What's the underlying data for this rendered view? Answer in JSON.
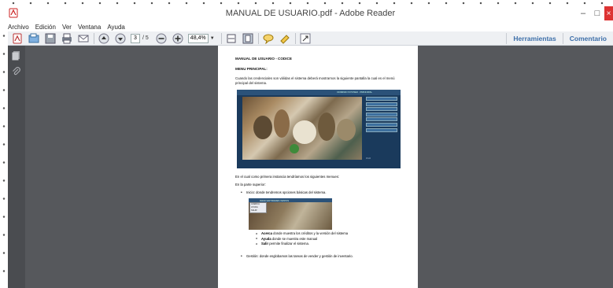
{
  "window": {
    "title": "MANUAL DE USUARIO.pdf - Adobe Reader",
    "minimize_glyph": "–",
    "maximize_glyph": "□",
    "close_glyph": "×"
  },
  "menu": {
    "items": [
      "Archivo",
      "Edición",
      "Ver",
      "Ventana",
      "Ayuda"
    ]
  },
  "toolbar": {
    "current_page": "3",
    "total_pages": "/ 5",
    "zoom": "48,4%",
    "tools_label": "Herramientas",
    "comment_label": "Comentario"
  },
  "icons": {
    "app": "adobe-reader-icon",
    "nav_pages": "pages-icon",
    "nav_attach": "paperclip-icon"
  },
  "colors": {
    "nav_pane": "#4a4c50",
    "document_bg": "#56585c",
    "link": "#3d6fa9"
  },
  "document": {
    "heading": "MANUAL DE USUARIO  - CODICE",
    "section": "MENU PRINCIPAL:",
    "intro": "Cuando las credenciales son válidas el sistema deberá mostrarnos la siguiente pantalla la cual es el menú principal del sistema.",
    "screenshot1_header": "DOMINIO SYSTEM · PRINCIPAL",
    "screenshot1_foot": "V.1.0",
    "after_screenshot": "En el cual como primera instancia tendríamos los siguientes menues:",
    "top_part": "En la parte superior:",
    "bullet1": "Inicio: donde tendremos opciones básicas del sistema.",
    "screenshot2_bar": "INICIO  ENTIDADES  VENTAS",
    "screenshot2_menu": [
      "ACERCA",
      "AYUDA",
      "SALIR"
    ],
    "sub_items": [
      {
        "term": "Acerca",
        "text": " donde muestra los créditos y la versión del sistema"
      },
      {
        "term": "Ayuda",
        "text": " donde se muestra este manual"
      },
      {
        "term": "Salir",
        "text": " permite finalizar el sistema."
      }
    ],
    "bullet2": "Gestión: donde englobamos las tareas de vender y gestión de inventario."
  }
}
